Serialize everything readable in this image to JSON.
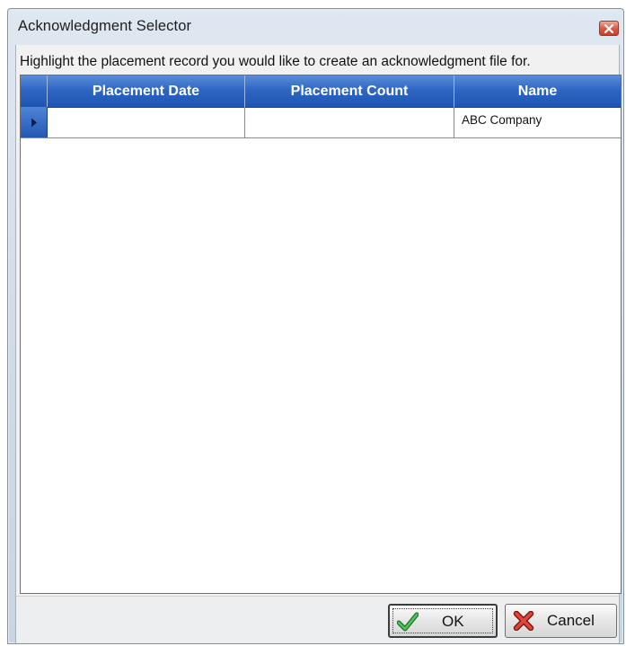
{
  "window": {
    "title": "Acknowledgment Selector"
  },
  "instruction": "Highlight the placement record you would like to create an acknowledgment file for.",
  "grid": {
    "columns": [
      "Placement Date",
      "Placement Count",
      "Name"
    ],
    "rows": [
      {
        "placement_date": "",
        "placement_count": "",
        "name": "ABC Company",
        "selected": true
      }
    ]
  },
  "buttons": {
    "ok_label": "OK",
    "cancel_label": "Cancel"
  },
  "colors": {
    "header_blue": "#2e66c4",
    "close_red": "#d8573f"
  },
  "icons": [
    "close-icon",
    "row-pointer-icon",
    "checkmark-icon",
    "cancel-x-icon"
  ]
}
